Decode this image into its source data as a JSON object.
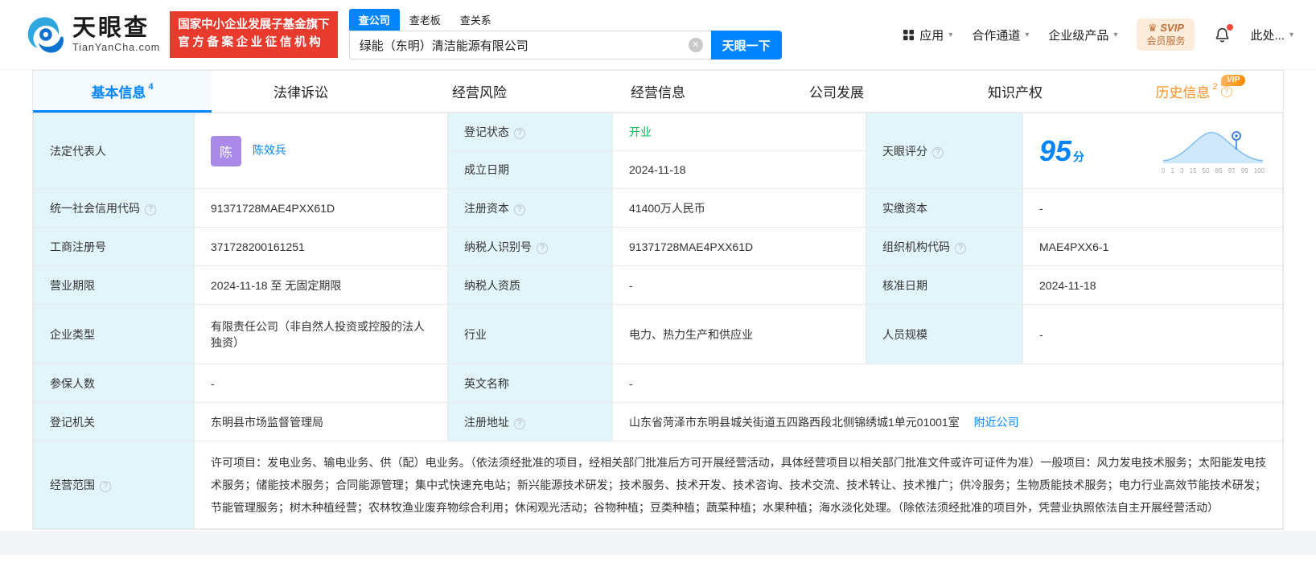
{
  "colors": {
    "primary": "#0084ff",
    "green": "#00bf57",
    "orange": "#ff8f1f",
    "badge_red": "#e93a2e",
    "label_bg": "#e2f5fa"
  },
  "icons": {
    "clear": "✕",
    "caret": "▾",
    "crown": "♛"
  },
  "header": {
    "logo_brand": "天眼查",
    "logo_domain": "TianYanCha.com",
    "cert_line1": "国家中小企业发展子基金旗下",
    "cert_line2": "官方备案企业征信机构",
    "search_tabs": [
      {
        "label": "查公司"
      },
      {
        "label": "查老板"
      },
      {
        "label": "查关系"
      }
    ],
    "search_value": "绿能（东明）清洁能源有限公司",
    "search_button": "天眼一下",
    "nav_apps": "应用",
    "nav_coop": "合作通道",
    "nav_enterprise": "企业级产品",
    "svip_title": "SVIP",
    "svip_sub": "会员服务",
    "user_more": "此处..."
  },
  "tabs": {
    "basic": "基本信息",
    "basic_count": "4",
    "legal": "法律诉讼",
    "risk": "经营风险",
    "operation": "经营信息",
    "development": "公司发展",
    "ip": "知识产权",
    "history": "历史信息",
    "history_count": "2",
    "history_vip": "VIP"
  },
  "info": {
    "legal_rep_label": "法定代表人",
    "legal_rep_avatar": "陈",
    "legal_rep_name": "陈效兵",
    "reg_status_label": "登记状态",
    "reg_status_value": "开业",
    "establish_label": "成立日期",
    "establish_value": "2024-11-18",
    "score_label": "天眼评分",
    "score_value": "95",
    "score_unit": "分",
    "score_axis": [
      "0",
      "1",
      "3",
      "15",
      "50",
      "85",
      "97",
      "99",
      "100"
    ],
    "credit_code_label": "统一社会信用代码",
    "credit_code_value": "91371728MAE4PXX61D",
    "reg_capital_label": "注册资本",
    "reg_capital_value": "41400万人民币",
    "paid_capital_label": "实缴资本",
    "paid_capital_value": "-",
    "reg_number_label": "工商注册号",
    "reg_number_value": "371728200161251",
    "taxpayer_id_label": "纳税人识别号",
    "taxpayer_id_value": "91371728MAE4PXX61D",
    "org_code_label": "组织机构代码",
    "org_code_value": "MAE4PXX6-1",
    "business_term_label": "营业期限",
    "business_term_value": "2024-11-18 至 无固定期限",
    "taxpayer_quality_label": "纳税人资质",
    "taxpayer_quality_value": "-",
    "approval_date_label": "核准日期",
    "approval_date_value": "2024-11-18",
    "company_type_label": "企业类型",
    "company_type_value": "有限责任公司（非自然人投资或控股的法人独资）",
    "industry_label": "行业",
    "industry_value": "电力、热力生产和供应业",
    "staff_size_label": "人员规模",
    "staff_size_value": "-",
    "insured_label": "参保人数",
    "insured_value": "-",
    "english_name_label": "英文名称",
    "english_name_value": "-",
    "reg_authority_label": "登记机关",
    "reg_authority_value": "东明县市场监督管理局",
    "address_label": "注册地址",
    "address_value": "山东省菏泽市东明县城关街道五四路西段北侧锦绣城1单元01001室",
    "address_link": "附近公司",
    "scope_label": "经营范围",
    "scope_value": "许可项目：发电业务、输电业务、供（配）电业务。（依法须经批准的项目，经相关部门批准后方可开展经营活动，具体经营项目以相关部门批准文件或许可证件为准）一般项目：风力发电技术服务；太阳能发电技术服务；储能技术服务；合同能源管理；集中式快速充电站；新兴能源技术研发；技术服务、技术开发、技术咨询、技术交流、技术转让、技术推广；供冷服务；生物质能技术服务；电力行业高效节能技术研发；节能管理服务；树木种植经营；农林牧渔业废弃物综合利用；休闲观光活动；谷物种植；豆类种植；蔬菜种植；水果种植；海水淡化处理。（除依法须经批准的项目外，凭营业执照依法自主开展经营活动）"
  }
}
